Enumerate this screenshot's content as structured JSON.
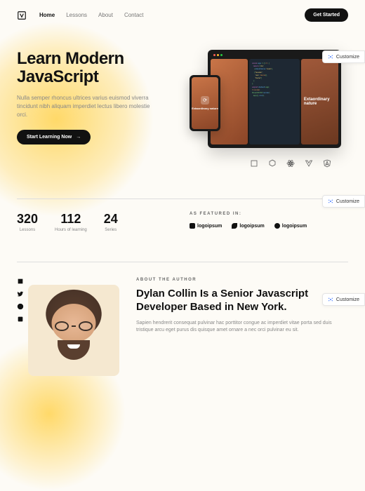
{
  "nav": {
    "items": [
      "Home",
      "Lessons",
      "About",
      "Contact"
    ],
    "active_index": 0,
    "cta": "Get Started"
  },
  "hero": {
    "title_l1": "Learn Modern",
    "title_l2": "JavaScript",
    "subtitle": "Nulla semper rhoncus ultrices varius euismod viverra tincidunt nibh aliquam imperdiet lectus libero molestie orci.",
    "cta": "Start Learning Now",
    "cta_arrow": "→",
    "screen_caption_right": "Extaordinary nature",
    "phone_caption": "Extaordinary nature",
    "traffic_colors": [
      "#ff5f56",
      "#ffbd2e",
      "#27c93f"
    ]
  },
  "tech_icons": [
    "js-icon",
    "node-icon",
    "react-icon",
    "vue-icon",
    "angular-icon"
  ],
  "stats": [
    {
      "num": "320",
      "label": "Lessons"
    },
    {
      "num": "112",
      "label": "Hours of learning"
    },
    {
      "num": "24",
      "label": "Series"
    }
  ],
  "featured": {
    "title": "AS FEATURED IN:",
    "logos": [
      "logoipsum",
      "logoipsum",
      "logoipsum"
    ]
  },
  "about": {
    "label": "ABOUT THE AUTHOR",
    "title": "Dylan Collin Is a Senior Javascript Developer Based in New York.",
    "text": "Sapien hendrerit consequat pulvinar hac porttitor congue ac imperdiet vitae porta sed duis tristique arcu eget purus dis quisque amet ornare a nec orci pulvinar eu sit."
  },
  "socials": [
    "medium-icon",
    "twitter-icon",
    "facebook-icon",
    "linkedin-icon"
  ],
  "customize_label": "Customize",
  "customize_positions": [
    72,
    278,
    418
  ]
}
